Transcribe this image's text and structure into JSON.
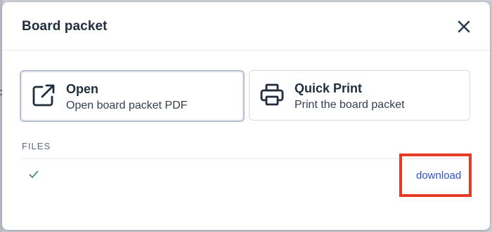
{
  "dialog": {
    "title": "Board packet",
    "close_icon": "close-icon"
  },
  "actions": [
    {
      "label": "Open",
      "description": "Open board packet PDF",
      "icon": "external-link-icon",
      "selected": true
    },
    {
      "label": "Quick Print",
      "description": "Print the board packet",
      "icon": "printer-icon",
      "selected": false
    }
  ],
  "files": {
    "section_label": "FILES",
    "rows": [
      {
        "status_icon": "checkmark-icon",
        "action_label": "download"
      }
    ]
  },
  "colors": {
    "title_text": "#1f2d3d",
    "link": "#2c55c9",
    "check": "#2f8a4c",
    "highlight": "#e53b24"
  }
}
